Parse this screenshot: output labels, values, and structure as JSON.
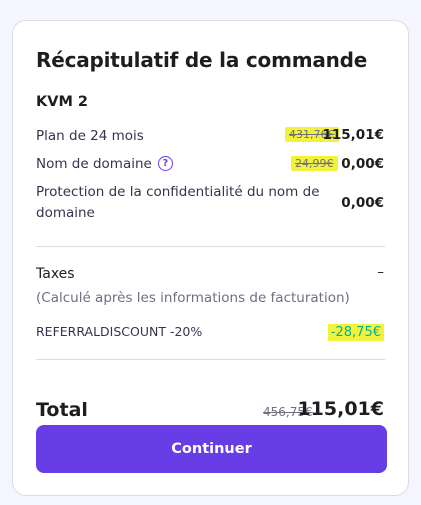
{
  "summary": {
    "title": "Récapitulatif de la commande",
    "product": "KVM 2"
  },
  "items": [
    {
      "label": "Plan de 24 mois",
      "old_price": "431,76€",
      "price": "115,01€"
    },
    {
      "label": "Nom de domaine",
      "old_price": "24,99€",
      "price": "0,00€",
      "help_icon": "question-circle-icon"
    },
    {
      "label_line1": "Protection de la confidentialité du nom de",
      "label_line2": "domaine",
      "price": "0,00€"
    }
  ],
  "taxes": {
    "label": "Taxes",
    "value": "–",
    "note": "(Calculé après les informations de facturation)"
  },
  "discount": {
    "label": "REFERRALDISCOUNT -20%",
    "value": "-28,75€"
  },
  "total": {
    "label": "Total",
    "old_price": "456,75€",
    "price": "115,01€"
  },
  "button": {
    "label": "Continuer"
  },
  "colors": {
    "accent": "#673de6",
    "highlight": "#f2f23c",
    "discount": "#00b090",
    "text": "#1d1e20"
  }
}
